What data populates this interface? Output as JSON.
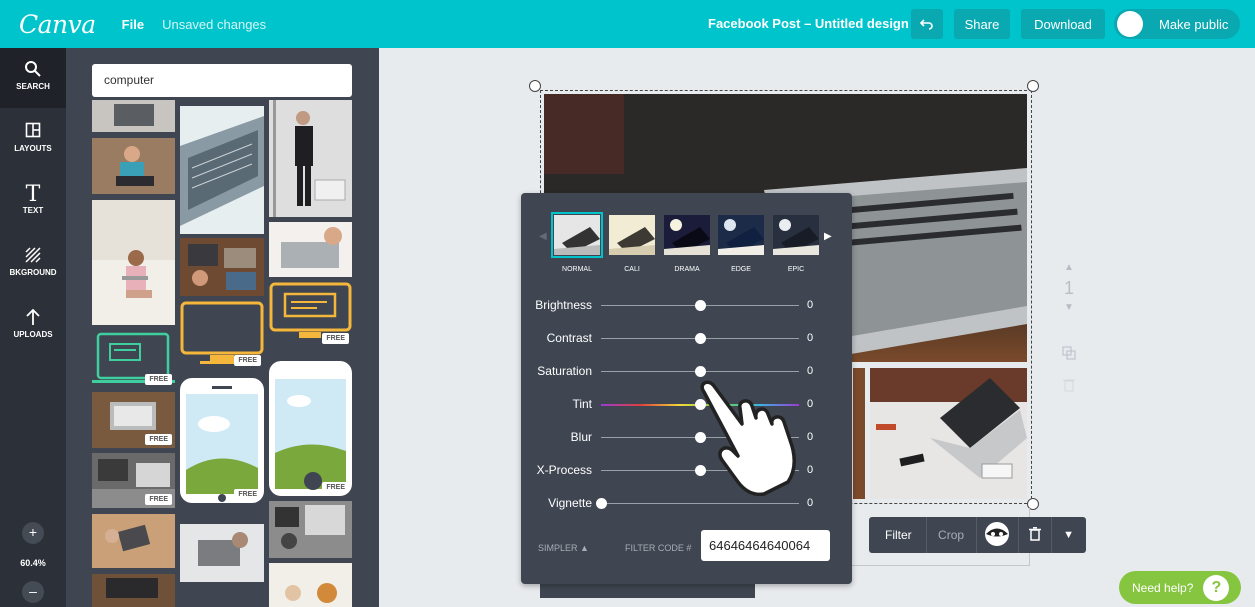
{
  "topbar": {
    "logo": "Canva",
    "menu_file": "File",
    "status": "Unsaved changes",
    "design_title": "Facebook Post – Untitled design",
    "undo_icon": "undo-icon",
    "share": "Share",
    "download": "Download",
    "make_public": "Make public"
  },
  "rail": {
    "items": [
      {
        "label": "SEARCH",
        "icon": "search-icon",
        "glyph": "⚲"
      },
      {
        "label": "LAYOUTS",
        "icon": "layouts-icon",
        "glyph": "◫"
      },
      {
        "label": "TEXT",
        "icon": "text-icon",
        "glyph": "T"
      },
      {
        "label": "BKGROUND",
        "icon": "background-icon",
        "glyph": "▨"
      },
      {
        "label": "UPLOADS",
        "icon": "upload-icon",
        "glyph": "↑"
      }
    ],
    "zoom_in": "+",
    "zoom_level": "60.4%",
    "zoom_out": "–"
  },
  "search": {
    "query": "computer"
  },
  "badges": {
    "free": "FREE"
  },
  "filters": {
    "presets": [
      "NORMAL",
      "CALI",
      "DRAMA",
      "EDGE",
      "EPIC"
    ],
    "selected_preset": "NORMAL",
    "sliders": [
      {
        "label": "Brightness",
        "value": "0",
        "pos": 0.5
      },
      {
        "label": "Contrast",
        "value": "0",
        "pos": 0.5
      },
      {
        "label": "Saturation",
        "value": "0",
        "pos": 0.5
      },
      {
        "label": "Tint",
        "value": "0",
        "pos": 0.5
      },
      {
        "label": "Blur",
        "value": "0",
        "pos": 0.5
      },
      {
        "label": "X-Process",
        "value": "0",
        "pos": 0.5
      },
      {
        "label": "Vignette",
        "value": "0",
        "pos": 0.0
      }
    ],
    "simpler": "SIMPLER ▲",
    "filter_code_label": "FILTER CODE #",
    "filter_code": "64646464640064"
  },
  "page_tools": {
    "page_number": "1"
  },
  "image_toolbar": {
    "filter": "Filter",
    "crop": "Crop"
  },
  "help": {
    "label": "Need help?",
    "icon": "?"
  },
  "colors": {
    "brand": "#00c4cc",
    "panel": "#3f4651",
    "rail": "#2c3038",
    "help": "#86c540"
  }
}
